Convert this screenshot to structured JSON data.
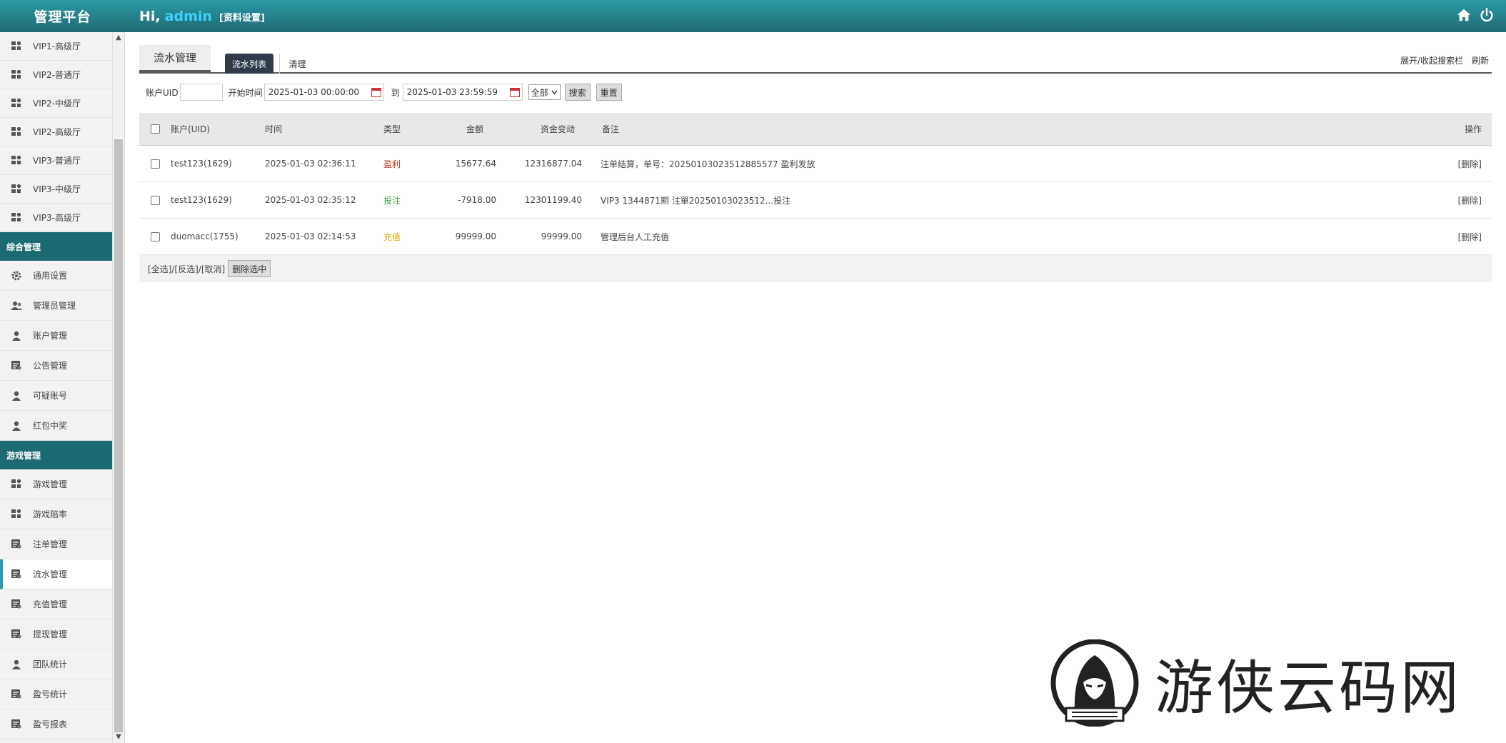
{
  "header": {
    "logo": "管理平台",
    "greeting": "Hi,",
    "username": "admin",
    "profile_link": "[资料设置]",
    "home_icon": "home-icon",
    "power_icon": "power-icon"
  },
  "sidebar": {
    "top_items": [
      {
        "label": "VIP1-高级厅",
        "icon": "grid-icon"
      },
      {
        "label": "VIP2-普通厅",
        "icon": "grid-icon"
      },
      {
        "label": "VIP2-中级厅",
        "icon": "grid-icon"
      },
      {
        "label": "VIP2-高级厅",
        "icon": "grid-icon"
      },
      {
        "label": "VIP3-普通厅",
        "icon": "grid-icon"
      },
      {
        "label": "VIP3-中级厅",
        "icon": "grid-icon"
      },
      {
        "label": "VIP3-高级厅",
        "icon": "grid-icon"
      }
    ],
    "group1": "综合管理",
    "group1_items": [
      {
        "label": "通用设置",
        "icon": "gear-icon"
      },
      {
        "label": "管理员管理",
        "icon": "users-icon"
      },
      {
        "label": "账户管理",
        "icon": "user-icon"
      },
      {
        "label": "公告管理",
        "icon": "list-icon"
      },
      {
        "label": "可疑账号",
        "icon": "user-icon"
      },
      {
        "label": "红包中奖",
        "icon": "user-icon"
      }
    ],
    "group2": "游戏管理",
    "group2_items": [
      {
        "label": "游戏管理",
        "icon": "grid-icon"
      },
      {
        "label": "游戏赔率",
        "icon": "grid-icon"
      },
      {
        "label": "注单管理",
        "icon": "list-icon"
      },
      {
        "label": "流水管理",
        "icon": "list-icon",
        "active": true
      },
      {
        "label": "充值管理",
        "icon": "list-icon"
      },
      {
        "label": "提现管理",
        "icon": "list-icon"
      },
      {
        "label": "团队统计",
        "icon": "user-icon"
      },
      {
        "label": "盈亏统计",
        "icon": "list-icon"
      },
      {
        "label": "盈亏报表",
        "icon": "list-icon"
      }
    ]
  },
  "tabs": {
    "page_title": "流水管理",
    "list_tab": "流水列表",
    "clean_tab": "清理",
    "toggle_search": "展开/收起搜索栏",
    "refresh": "刷新"
  },
  "search": {
    "uid_label": "账户UID",
    "uid_value": "",
    "start_label": "开始时间",
    "start_value": "2025-01-03 00:00:00",
    "to_label": "到",
    "end_value": "2025-01-03 23:59:59",
    "type_select": "全部",
    "search_btn": "搜索",
    "reset_btn": "重置"
  },
  "table": {
    "headers": {
      "account": "账户(UID)",
      "time": "时间",
      "type": "类型",
      "amount": "金额",
      "fund_change": "资金变动",
      "note": "备注",
      "op": "操作"
    },
    "rows": [
      {
        "account": "test123(1629)",
        "time": "2025-01-03 02:36:11",
        "type": "盈利",
        "type_color": "#c0392b",
        "amount": "15677.64",
        "fund_change": "12316877.04",
        "note": "注单结算，单号：20250103023512885577 盈利发放",
        "op": "[删除]"
      },
      {
        "account": "test123(1629)",
        "time": "2025-01-03 02:35:12",
        "type": "投注",
        "type_color": "#2e9c3a",
        "amount": "-7918.00",
        "fund_change": "12301199.40",
        "note": "VIP3 1344871期 注單20250103023512...投注",
        "op": "[删除]"
      },
      {
        "account": "duomacc(1755)",
        "time": "2025-01-03 02:14:53",
        "type": "充值",
        "type_color": "#e0a800",
        "amount": "99999.00",
        "fund_change": "99999.00",
        "note": "管理后台人工充值",
        "op": "[删除]"
      }
    ],
    "footer": {
      "select_all": "[全选]",
      "sep1": "/",
      "invert": "[反选]",
      "sep2": "/",
      "cancel": "[取消]",
      "delete_selected": "删除选中"
    }
  },
  "watermark": {
    "text": "游侠云码网"
  }
}
